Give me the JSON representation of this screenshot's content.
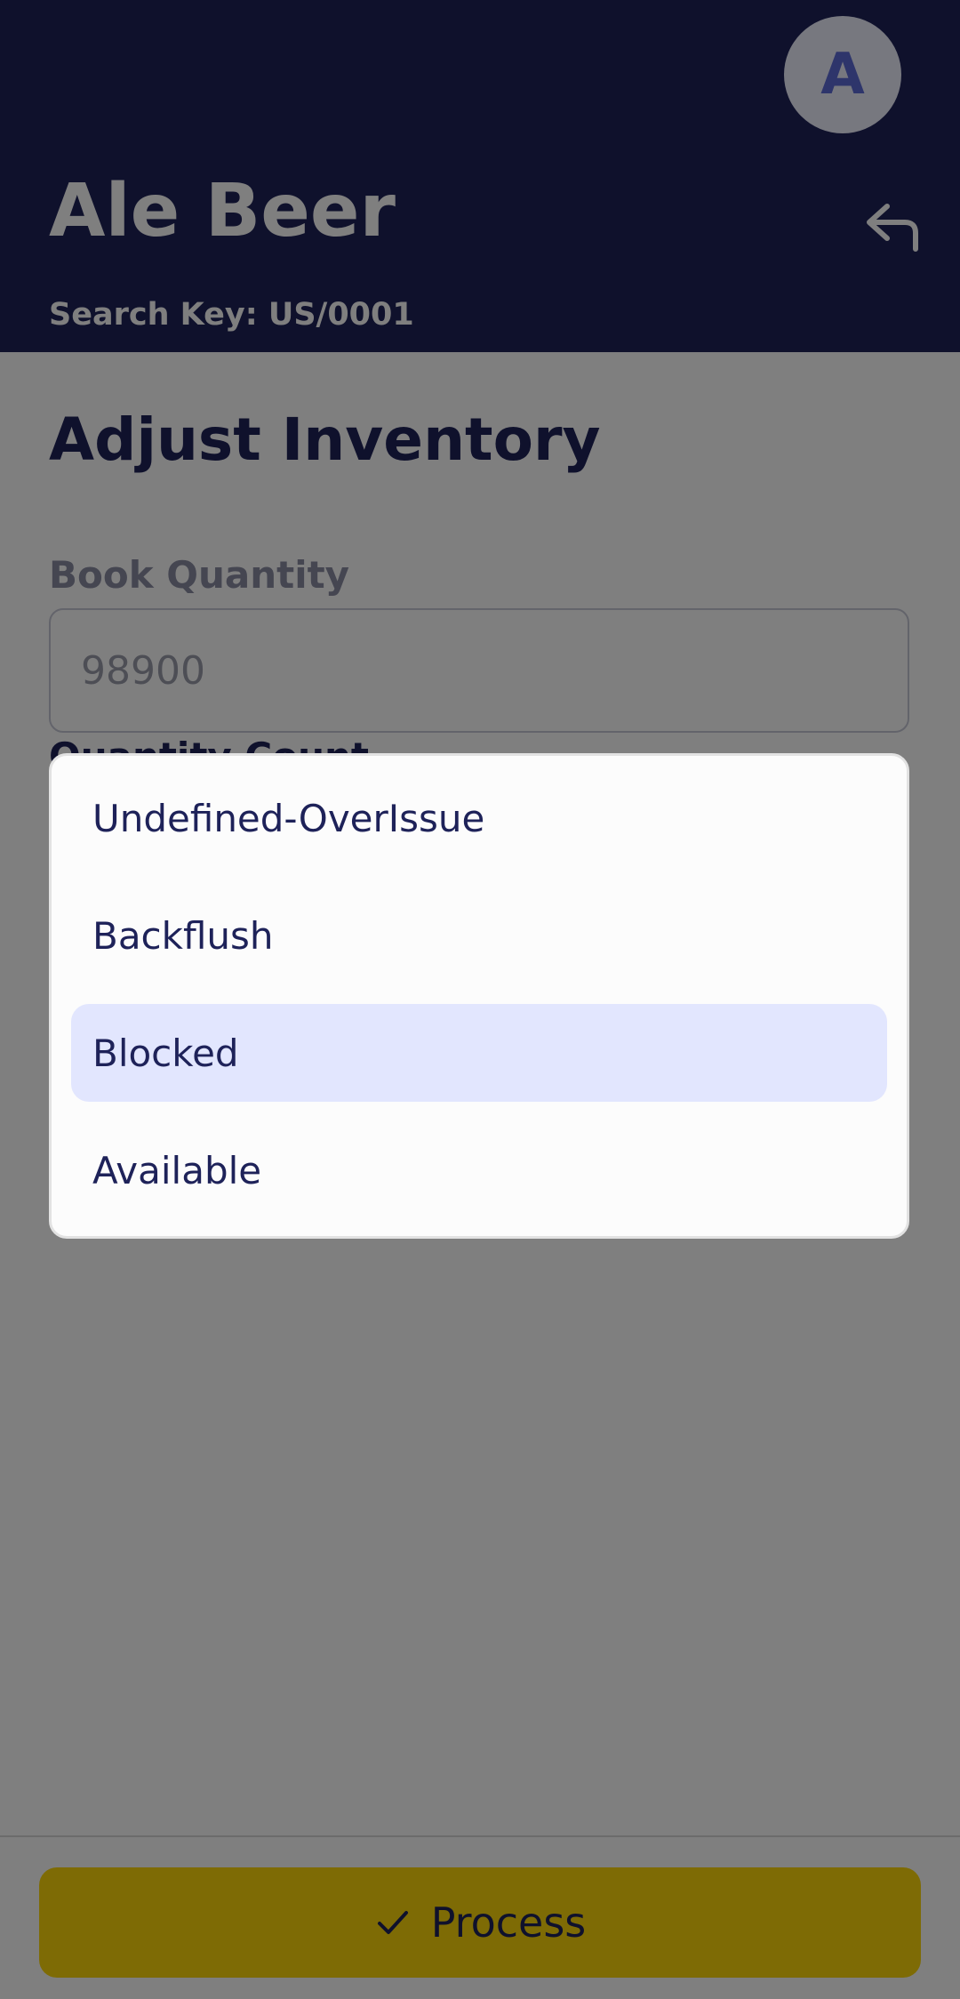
{
  "header": {
    "avatar_initial": "A",
    "product_name": "Ale Beer",
    "search_key": "Search Key: US/0001",
    "back_icon": "back-arrow-icon"
  },
  "content": {
    "section_title": "Adjust Inventory",
    "book_quantity_label": "Book Quantity",
    "book_quantity_value": "98900",
    "quantity_count_label": "Quantity Count"
  },
  "dropdown": {
    "options": [
      {
        "label": "Undefined-OverIssue",
        "selected": false
      },
      {
        "label": "Backflush",
        "selected": false
      },
      {
        "label": "Blocked",
        "selected": true
      },
      {
        "label": "Available",
        "selected": false
      }
    ]
  },
  "footer": {
    "process_label": "Process",
    "process_icon": "check-icon"
  },
  "colors": {
    "header_bg": "#1e2259",
    "accent_yellow": "#fdd70a",
    "selected_bg": "#e2e6fe",
    "text_dark": "#1e2259"
  }
}
